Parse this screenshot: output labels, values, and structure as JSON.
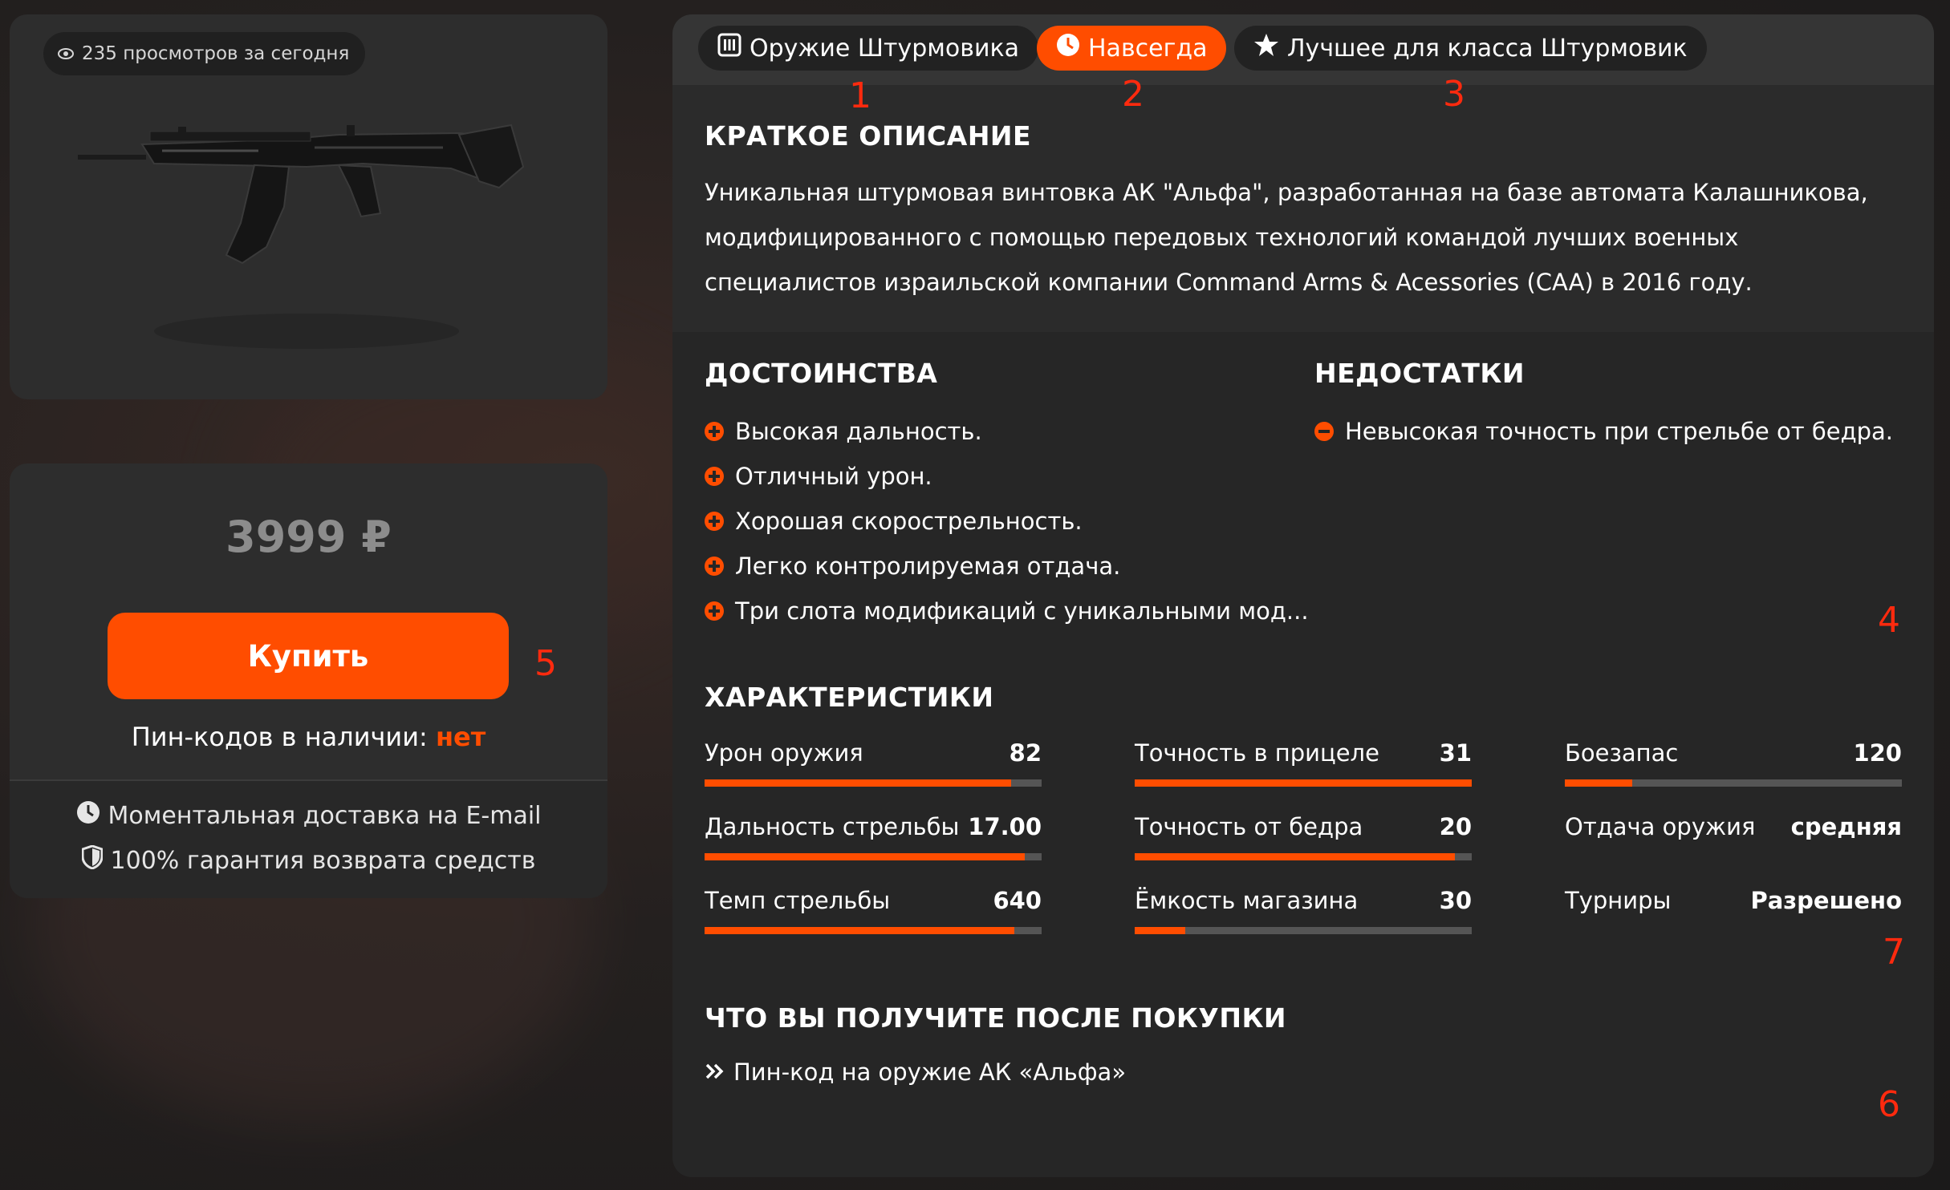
{
  "colors": {
    "accent": "#ff4d00",
    "panel": "#262626",
    "card": "#2d2d2d",
    "marker": "#ff2a0e"
  },
  "product": {
    "views_text": "235 просмотров за сегодня",
    "views_icon": "eye-icon",
    "image": "rifle-ak-alpha-image"
  },
  "purchase": {
    "price": "3999 ₽",
    "buy_label": "Купить",
    "stock_label": "Пин-кодов в наличии:",
    "stock_value": "нет",
    "guarantees": [
      {
        "icon": "clock-icon",
        "text": "Моментальная доставка на E-mail"
      },
      {
        "icon": "shield-icon",
        "text": "100% гарантия возврата средств"
      }
    ]
  },
  "tabs": [
    {
      "icon": "magazine-icon",
      "label": "Оружие Штурмовика",
      "active": false
    },
    {
      "icon": "clock-icon",
      "label": "Навсегда",
      "active": true
    },
    {
      "icon": "star-icon",
      "label": "Лучшее для класса Штурмовик",
      "active": false
    }
  ],
  "description": {
    "title": "КРАТКОЕ ОПИСАНИЕ",
    "text": "Уникальная штурмовая винтовка АК \"Альфа\", разработанная на базе автомата Калашникова, модифицированного с помощью передовых технологий командой лучших военных специалистов израильской компании Command Arms & Acessories (CAA) в 2016 году."
  },
  "pros": {
    "title": "ДОСТОИНСТВА",
    "items": [
      "Высокая дальность.",
      "Отличный урон.",
      "Хорошая скорострельность.",
      "Легко контролируемая отдача.",
      "Три слота модификаций с уникальными мод..."
    ]
  },
  "cons": {
    "title": "НЕДОСТАТКИ",
    "items": [
      "Невысокая точность при стрельбе от бедра."
    ]
  },
  "stats": {
    "title": "ХАРАКТЕРИСТИКИ",
    "items": [
      {
        "name": "Урон оружия",
        "value": "82",
        "fill": 0.91
      },
      {
        "name": "Точность в прицеле",
        "value": "31",
        "fill": 1.0
      },
      {
        "name": "Боезапас",
        "value": "120",
        "fill": 0.2
      },
      {
        "name": "Дальность стрельбы",
        "value": "17.00",
        "fill": 0.95
      },
      {
        "name": "Точность от бедра",
        "value": "20",
        "fill": 0.95
      },
      {
        "name": "Отдача оружия",
        "value": "средняя",
        "fill": null
      },
      {
        "name": "Темп стрельбы",
        "value": "640",
        "fill": 0.92
      },
      {
        "name": "Ёмкость магазина",
        "value": "30",
        "fill": 0.15
      },
      {
        "name": "Турниры",
        "value": "Разрешено",
        "fill": null
      }
    ]
  },
  "rewards": {
    "title": "ЧТО ВЫ ПОЛУЧИТЕ ПОСЛЕ ПОКУПКИ",
    "items": [
      "Пин-код на оружие АК «Альфа»"
    ]
  },
  "markers": [
    "1",
    "2",
    "3",
    "4",
    "5",
    "6",
    "7"
  ]
}
